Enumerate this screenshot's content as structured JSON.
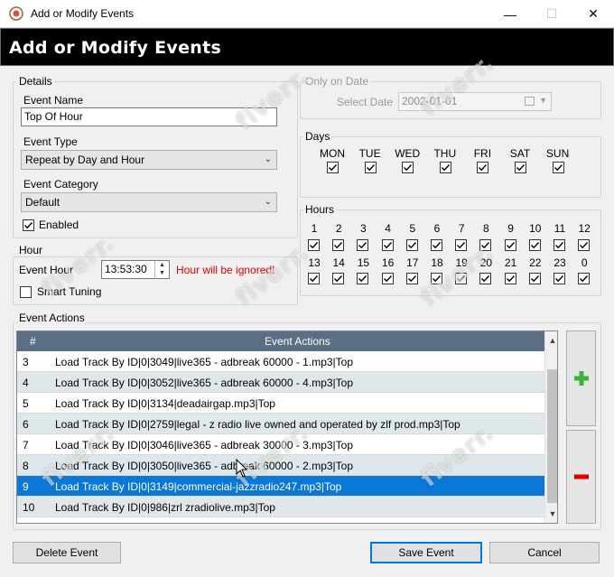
{
  "window": {
    "title": "Add or Modify Events",
    "header_title": "Add or Modify Events",
    "minimize_glyph": "—",
    "maximize_glyph": "☐",
    "close_glyph": "✕"
  },
  "details": {
    "group_label": "Details",
    "event_name_label": "Event Name",
    "event_name_value": "Top Of Hour",
    "event_type_label": "Event Type",
    "event_type_value": "Repeat by Day and Hour",
    "event_category_label": "Event Category",
    "event_category_value": "Default",
    "enabled_label": "Enabled",
    "enabled_checked": true
  },
  "hour_section": {
    "group_label": "Hour",
    "event_hour_label": "Event Hour",
    "event_hour_value": "13:53:30",
    "warning": "Hour will be ignored!",
    "smart_tuning_label": "Smart Tuning",
    "smart_tuning_checked": false
  },
  "only_on_date": {
    "group_label": "Only on Date",
    "select_date_label": "Select Date",
    "date_value": "2002-01-01"
  },
  "days": {
    "group_label": "Days",
    "items": [
      {
        "label": "MON",
        "checked": true
      },
      {
        "label": "TUE",
        "checked": true
      },
      {
        "label": "WED",
        "checked": true
      },
      {
        "label": "THU",
        "checked": true
      },
      {
        "label": "FRI",
        "checked": true
      },
      {
        "label": "SAT",
        "checked": true
      },
      {
        "label": "SUN",
        "checked": true
      }
    ]
  },
  "hours": {
    "group_label": "Hours",
    "row1": [
      "1",
      "2",
      "3",
      "4",
      "5",
      "6",
      "7",
      "8",
      "9",
      "10",
      "11",
      "12"
    ],
    "row2": [
      "13",
      "14",
      "15",
      "16",
      "17",
      "18",
      "19",
      "20",
      "21",
      "22",
      "23",
      "0"
    ]
  },
  "event_actions": {
    "group_label": "Event Actions",
    "columns": [
      "#",
      "Event Actions"
    ],
    "rows": [
      {
        "num": "3",
        "action": "Load Track By ID|0|3049|live365 - adbreak  60000 - 1.mp3|Top",
        "style": "normal"
      },
      {
        "num": "4",
        "action": "Load Track By ID|0|3052|live365 - adbreak  60000 - 4.mp3|Top",
        "style": "alt"
      },
      {
        "num": "5",
        "action": "Load Track By ID|0|3134|deadairgap.mp3|Top",
        "style": "normal"
      },
      {
        "num": "6",
        "action": "Load Track By ID|0|2759|legal - z radio live owned and operated by zlf prod.mp3|Top",
        "style": "alt"
      },
      {
        "num": "7",
        "action": "Load Track By ID|0|3046|live365 - adbreak  30000 - 3.mp3|Top",
        "style": "normal"
      },
      {
        "num": "8",
        "action": "Load Track By ID|0|3050|live365 - adbreak  60000 - 2.mp3|Top",
        "style": "alt"
      },
      {
        "num": "9",
        "action": "Load Track By ID|0|3149|commercial-jazzradio247.mp3|Top",
        "style": "sel"
      },
      {
        "num": "10",
        "action": "Load Track By ID|0|986|zrl  zradiolive.mp3|Top",
        "style": "alt"
      }
    ]
  },
  "buttons": {
    "delete_event": "Delete Event",
    "save_event": "Save Event",
    "cancel": "Cancel"
  },
  "watermark": {
    "text": "fiverr."
  },
  "colors": {
    "header_band": "#000000",
    "table_header": "#5a6e85",
    "selected_row": "#0a78d7",
    "alt_row": "#dfe7ea",
    "warning": "#e00000",
    "add_icon": "#3cb43c",
    "remove_icon": "#e00000"
  }
}
